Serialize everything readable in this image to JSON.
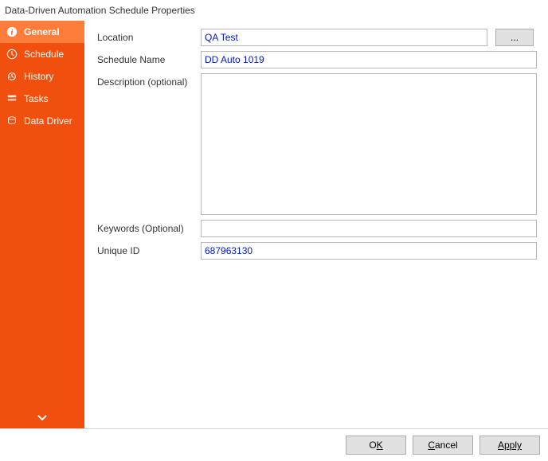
{
  "window": {
    "title": "Data-Driven Automation Schedule Properties"
  },
  "sidebar": {
    "items": [
      {
        "label": "General"
      },
      {
        "label": "Schedule"
      },
      {
        "label": "History"
      },
      {
        "label": "Tasks"
      },
      {
        "label": "Data Driver"
      }
    ]
  },
  "form": {
    "location_label": "Location",
    "location_value": "QA Test",
    "browse_label": "...",
    "schedule_name_label": "Schedule Name",
    "schedule_name_value": "DD Auto 1019",
    "description_label": "Description (optional)",
    "description_value": "",
    "keywords_label": "Keywords (Optional)",
    "keywords_value": "",
    "unique_id_label": "Unique ID",
    "unique_id_value": "687963130"
  },
  "footer": {
    "ok_pre": "O",
    "ok_ul": "K",
    "cancel_ul": "C",
    "cancel_post": "ancel",
    "apply_ul": "Apply"
  }
}
